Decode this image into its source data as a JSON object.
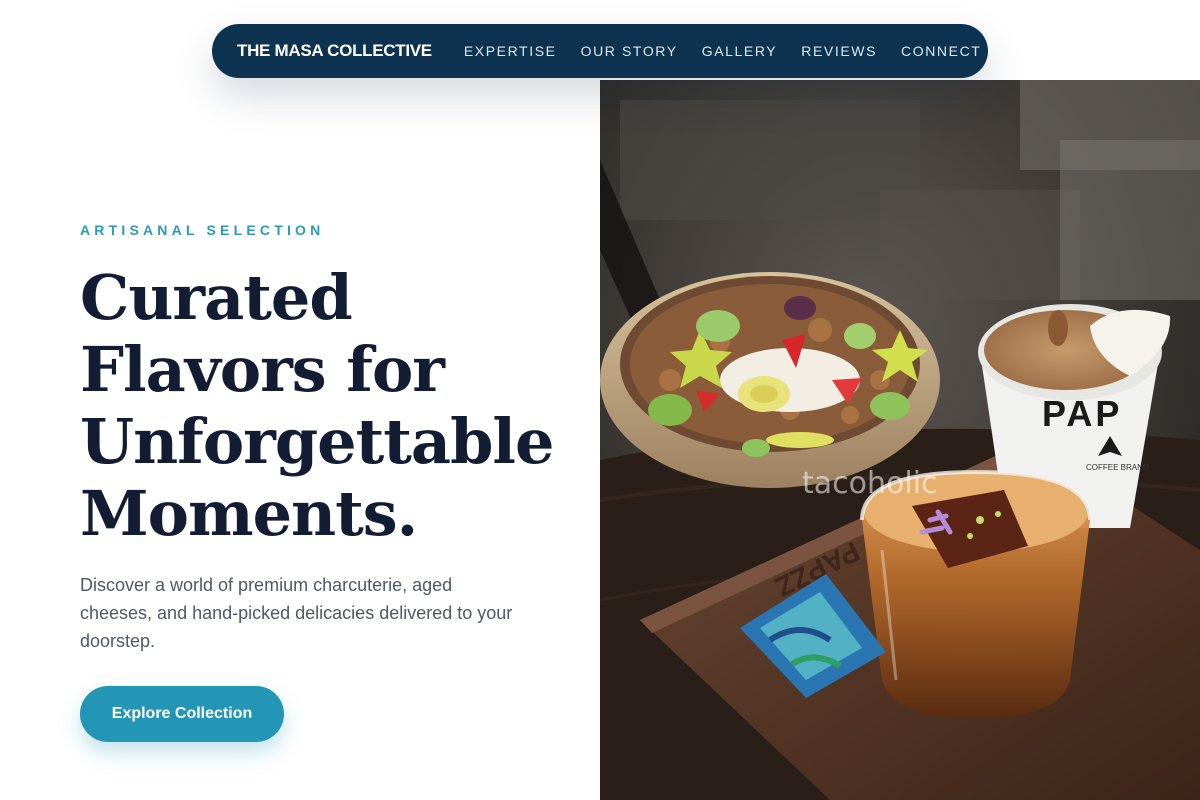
{
  "nav": {
    "brand": "THE MASA COLLECTIVE",
    "links": [
      "EXPERTISE",
      "OUR STORY",
      "GALLERY",
      "REVIEWS",
      "CONNECT"
    ]
  },
  "hero": {
    "eyebrow": "ARTISANAL SELECTION",
    "headline": "Curated Flavors for Unforgettable Moments.",
    "subtext": "Discover a world of premium charcuterie, aged cheeses, and hand-picked delicacies delivered to your doorstep.",
    "cta_label": "Explore Collection"
  },
  "photo": {
    "cup_print": "PAP",
    "cup_small": "COFFEE BRAND",
    "tray_engraving": "PAPZZ",
    "watermark": "tacoholic"
  },
  "colors": {
    "nav_bg": "#0d3350",
    "accent": "#2396b5",
    "heading": "#121c33",
    "body_text": "#4e5866"
  }
}
